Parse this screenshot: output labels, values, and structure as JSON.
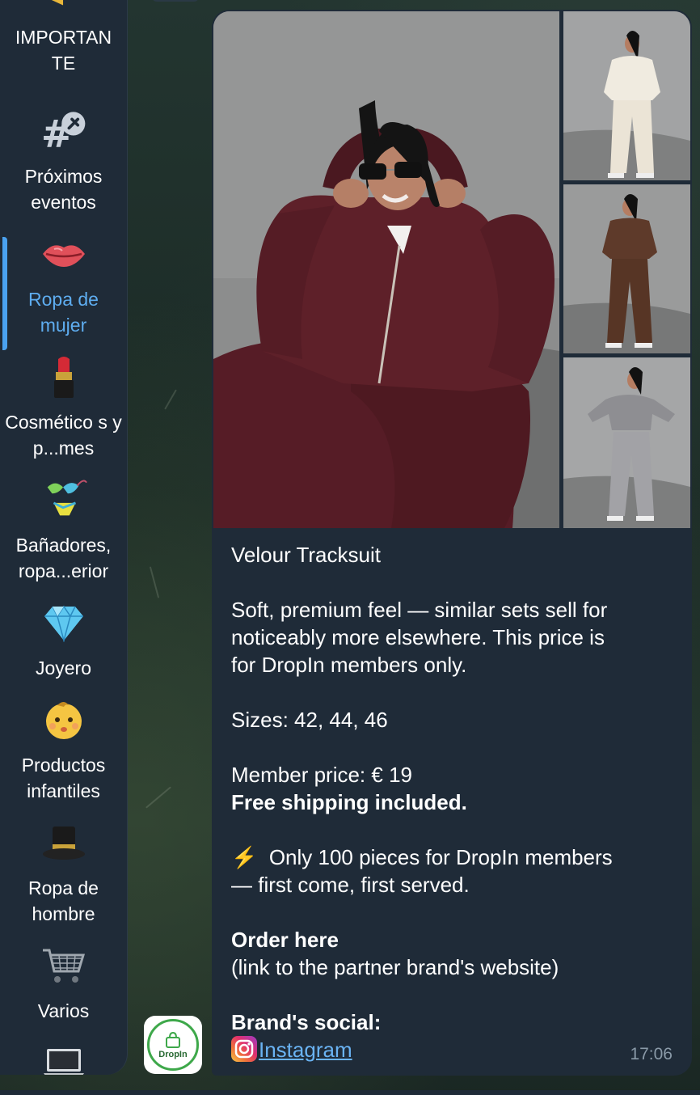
{
  "sidebar": {
    "folders": [
      {
        "label": "IMPORTAN TE",
        "icon": "megaphone-icon"
      },
      {
        "label": "Próximos eventos",
        "icon": "hashtag-pin-icon"
      },
      {
        "label": "Ropa de mujer",
        "icon": "lips-icon",
        "active": true
      },
      {
        "label": "Cosmético s y p...mes",
        "icon": "lipstick-icon"
      },
      {
        "label": "Bañadores, ropa...erior",
        "icon": "bikini-icon"
      },
      {
        "label": "Joyero",
        "icon": "gem-icon"
      },
      {
        "label": "Productos infantiles",
        "icon": "baby-icon"
      },
      {
        "label": "Ropa de hombre",
        "icon": "top-hat-icon"
      },
      {
        "label": "Varios",
        "icon": "shopping-cart-icon"
      },
      {
        "label": "",
        "icon": "laptop-icon"
      }
    ],
    "accent_color": "#5eadf0"
  },
  "avatar": {
    "name": "DropIn",
    "icon": "shopping-bag-icon",
    "ring_color": "#3ea84a"
  },
  "message": {
    "photos": [
      {
        "desc": "main-photo",
        "outfit_color": "#5a1f28"
      },
      {
        "desc": "thumb-cream",
        "outfit_color": "#efe8da"
      },
      {
        "desc": "thumb-brown",
        "outfit_color": "#5c3a2a"
      },
      {
        "desc": "thumb-grey",
        "outfit_color": "#9a9a9e"
      }
    ],
    "title": "Velour Tracksuit",
    "desc_line1": "Soft, premium feel — similar sets sell for",
    "desc_line2": "noticeably more elsewhere. This price is",
    "desc_line3": "for DropIn members only.",
    "sizes": "Sizes: 42, 44, 46",
    "price": "Member price: € 19",
    "shipping": "Free shipping included.",
    "stock_emoji": "⚡",
    "stock_line1": "Only 100 pieces for DropIn members",
    "stock_line2": "— first come, first served.",
    "order_title": "Order here",
    "order_note": "(link to the partner brand's website)",
    "social_title": "Brand's social:",
    "social_link": "Instagram",
    "time": "17:06"
  }
}
